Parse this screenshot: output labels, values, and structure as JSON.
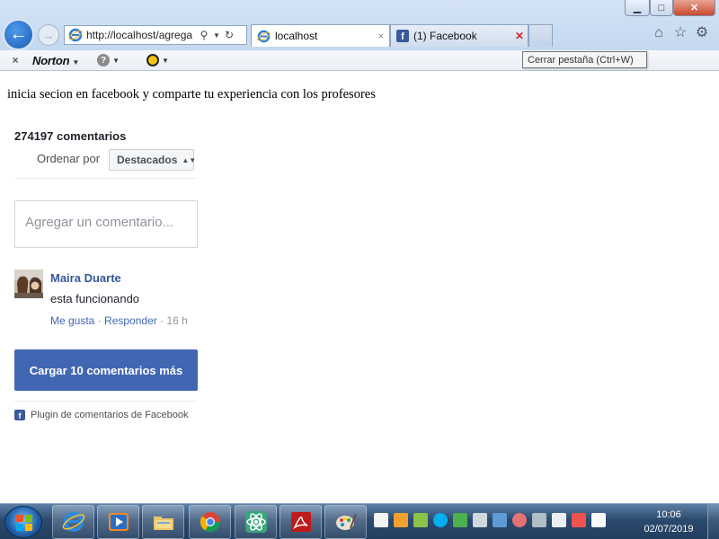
{
  "browser": {
    "url": "http://localhost/agrega",
    "tabs": [
      {
        "label": "localhost",
        "close": "×"
      },
      {
        "label": "(1) Facebook",
        "close": "✕"
      }
    ],
    "tooltip": "Cerrar pestaña (Ctrl+W)",
    "window_buttons": {
      "minimize": "▁",
      "maximize": "□",
      "close": "✕"
    },
    "command_bar": {
      "close": "×",
      "norton": "Norton"
    },
    "icons": [
      "back-arrow-icon",
      "forward-arrow-icon",
      "ie-icon",
      "search-icon",
      "refresh-icon",
      "home-icon",
      "favorites-star-icon",
      "gear-icon"
    ]
  },
  "page": {
    "intro_text": "inicia secion en facebook y comparte tu experiencia con los profesores"
  },
  "comments": {
    "count": "274197 comentarios",
    "sort_label": "Ordenar por",
    "sort_value": "Destacados",
    "input_placeholder": "Agregar un comentario...",
    "items": [
      {
        "author": "Maira Duarte",
        "text": "esta funcionando",
        "like": "Me gusta",
        "separator1": " · ",
        "reply": "Responder",
        "separator2": " · ",
        "time": "16 h"
      }
    ],
    "load_more": "Cargar 10 comentarios más",
    "plugin_label": "Plugin de comentarios de Facebook"
  },
  "taskbar": {
    "time": "10:06",
    "date": "02/07/2019",
    "apps": [
      "internet-explorer-icon",
      "media-player-icon",
      "file-explorer-icon",
      "chrome-icon",
      "atom-icon",
      "acrobat-icon",
      "paint-icon"
    ]
  },
  "colors": {
    "fb_blue": "#4267b2",
    "fb_link": "#365899",
    "tab_close_red": "#dd2222"
  }
}
